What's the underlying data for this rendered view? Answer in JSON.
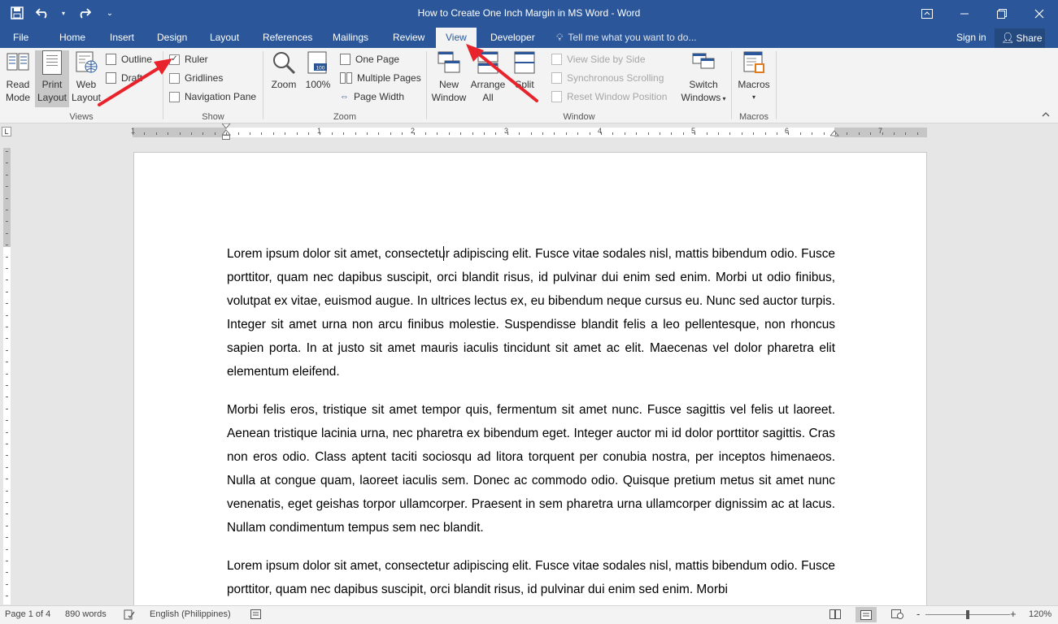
{
  "window": {
    "title": "How to Create One Inch Margin in MS Word - Word",
    "controls": [
      "restore-ribbon",
      "minimize",
      "restore",
      "close"
    ]
  },
  "tabs": [
    {
      "label": "File"
    },
    {
      "label": "Home"
    },
    {
      "label": "Insert"
    },
    {
      "label": "Design"
    },
    {
      "label": "Layout"
    },
    {
      "label": "References"
    },
    {
      "label": "Mailings"
    },
    {
      "label": "Review"
    },
    {
      "label": "View",
      "active": true
    },
    {
      "label": "Developer"
    }
  ],
  "tell_me": "Tell me what you want to do...",
  "sign_in": "Sign in",
  "share": "Share",
  "ribbon": {
    "views": {
      "label": "Views",
      "read_mode": [
        "Read",
        "Mode"
      ],
      "print_layout": [
        "Print",
        "Layout"
      ],
      "web_layout": [
        "Web",
        "Layout"
      ],
      "outline": "Outline",
      "draft": "Draft"
    },
    "show": {
      "label": "Show",
      "ruler": {
        "label": "Ruler",
        "checked": true
      },
      "gridlines": {
        "label": "Gridlines",
        "checked": false
      },
      "navigation_pane": {
        "label": "Navigation Pane",
        "checked": false
      }
    },
    "zoom": {
      "label": "Zoom",
      "zoom": "Zoom",
      "hundred": "100%",
      "one_page": "One Page",
      "multiple_pages": "Multiple Pages",
      "page_width": "Page Width"
    },
    "window": {
      "label": "Window",
      "new_window": [
        "New",
        "Window"
      ],
      "arrange_all": [
        "Arrange",
        "All"
      ],
      "split": "Split",
      "view_side_by_side": "View Side by Side",
      "synchronous_scrolling": "Synchronous Scrolling",
      "reset_window_position": "Reset Window Position",
      "switch_windows": [
        "Switch",
        "Windows"
      ]
    },
    "macros": {
      "label": "Macros",
      "macros": "Macros"
    }
  },
  "ruler_numbers": [
    "1",
    "1",
    "2",
    "3",
    "4",
    "5",
    "6",
    "7"
  ],
  "document": {
    "paragraphs": [
      "Lorem ipsum dolor sit amet, consectetur adipiscing elit. Fusce vitae sodales nisl, mattis bibendum odio. Fusce porttitor, quam nec dapibus suscipit, orci blandit risus, id pulvinar dui enim sed enim. Morbi ut odio finibus, volutpat ex vitae, euismod augue. In ultrices lectus ex, eu bibendum neque cursus eu. Nunc sed auctor turpis. Integer sit amet urna non arcu finibus molestie. Suspendisse blandit felis a leo pellentesque, non rhoncus sapien porta. In at justo sit amet mauris iaculis tincidunt sit amet ac elit. Maecenas vel dolor pharetra elit elementum eleifend.",
      "Morbi felis eros, tristique sit amet tempor quis, fermentum sit amet nunc. Fusce sagittis vel felis ut laoreet. Aenean tristique lacinia urna, nec pharetra ex bibendum eget. Integer auctor mi id dolor porttitor sagittis. Cras non eros odio. Class aptent taciti sociosqu ad litora torquent per conubia nostra, per inceptos himenaeos. Nulla at congue quam, laoreet iaculis sem. Donec ac commodo odio. Quisque pretium metus sit amet nunc venenatis, eget geishas torpor ullamcorper. Praesent in sem pharetra urna ullamcorper dignissim ac at lacus. Nullam condimentum tempus sem nec blandit.",
      "Lorem ipsum dolor sit amet, consectetur adipiscing elit. Fusce vitae sodales nisl, mattis bibendum odio. Fusce porttitor, quam nec dapibus suscipit, orci blandit risus, id pulvinar dui enim sed enim. Morbi"
    ]
  },
  "status": {
    "page": "Page 1 of 4",
    "words": "890 words",
    "language": "English (Philippines)",
    "zoom": "120%",
    "zoom_minus": "-",
    "zoom_plus": "+"
  },
  "colors": {
    "brand": "#2b579a",
    "annotation_arrow": "#e8232b"
  }
}
